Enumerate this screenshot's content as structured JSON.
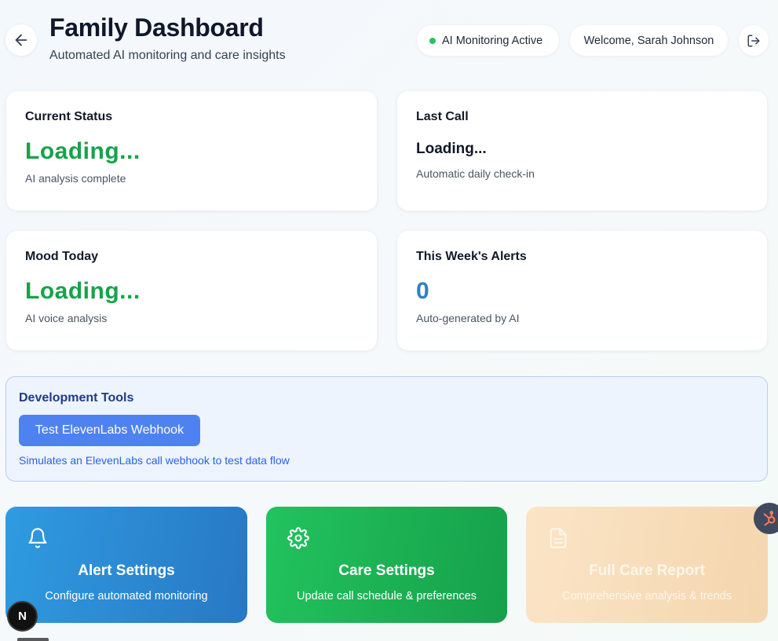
{
  "header": {
    "title": "Family Dashboard",
    "subtitle": "Automated AI monitoring and care insights",
    "monitoring_status": "AI Monitoring Active",
    "welcome": "Welcome, Sarah Johnson",
    "back_icon": "arrow-left-icon",
    "logout_icon": "logout-icon"
  },
  "cards": {
    "current_status": {
      "title": "Current Status",
      "value": "Loading...",
      "note": "AI analysis complete"
    },
    "last_call": {
      "title": "Last Call",
      "value": "Loading...",
      "note": "Automatic daily check-in"
    },
    "mood_today": {
      "title": "Mood Today",
      "value": "Loading...",
      "note": "AI voice analysis"
    },
    "week_alerts": {
      "title": "This Week's Alerts",
      "value": "0",
      "note": "Auto-generated by AI"
    }
  },
  "dev_tools": {
    "title": "Development Tools",
    "button_label": "Test ElevenLabs Webhook",
    "note": "Simulates an ElevenLabs call webhook to test data flow"
  },
  "actions": {
    "alert_settings": {
      "title": "Alert Settings",
      "subtitle": "Configure automated monitoring",
      "icon": "bell-icon"
    },
    "care_settings": {
      "title": "Care Settings",
      "subtitle": "Update call schedule & preferences",
      "icon": "gear-icon"
    },
    "full_care_report": {
      "title": "Full Care Report",
      "subtitle": "Comprehensive analysis & trends",
      "icon": "document-icon"
    }
  },
  "overlays": {
    "next_badge": "N",
    "hub_icon": "hubspot-icon"
  },
  "colors": {
    "status_green": "#16a34a",
    "alerts_blue": "#2f80c4",
    "dev_button": "#4f82f1",
    "alert_card": "#2f9be0",
    "care_card": "#22c35e",
    "report_card": "#f4d6ae"
  }
}
